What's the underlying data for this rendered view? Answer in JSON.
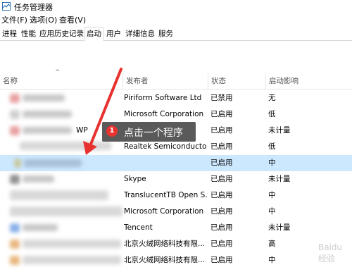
{
  "window": {
    "title": "任务管理器"
  },
  "menu": [
    "文件(F)",
    "选项(O)",
    "查看(V)"
  ],
  "tabs": [
    {
      "label": "进程"
    },
    {
      "label": "性能"
    },
    {
      "label": "应用历史记录"
    },
    {
      "label": "启动",
      "active": true
    },
    {
      "label": "用户"
    },
    {
      "label": "详细信息"
    },
    {
      "label": "服务"
    }
  ],
  "columns": {
    "name": "名称",
    "publisher": "发布者",
    "status": "状态",
    "impact": "启动影响"
  },
  "rows": [
    {
      "name_partial": "",
      "publisher": "Piriform Software Ltd",
      "status": "已禁用",
      "impact": "无"
    },
    {
      "name_partial": "",
      "publisher": "Microsoft Corporation",
      "status": "已启用",
      "impact": "低"
    },
    {
      "name_partial": "WP",
      "publisher": "",
      "status": "已启用",
      "impact": "未计量"
    },
    {
      "name_partial": "",
      "publisher": "Realtek Semiconductor",
      "status": "已启用",
      "impact": "低"
    },
    {
      "name_partial": "",
      "publisher": "",
      "status": "已启用",
      "impact": "中",
      "selected": true
    },
    {
      "name_partial": "",
      "publisher": "Skype",
      "status": "已启用",
      "impact": "未计量"
    },
    {
      "name_partial": "",
      "publisher": "TranslucentTB Open S...",
      "status": "已启用",
      "impact": "中"
    },
    {
      "name_partial": "",
      "publisher": "Microsoft Corporation",
      "status": "已启用",
      "impact": "中"
    },
    {
      "name_partial": "",
      "publisher": "Tencent",
      "status": "已启用",
      "impact": "未计量"
    },
    {
      "name_partial": "",
      "publisher": "北京火绒网络科技有限...",
      "status": "已启用",
      "impact": "高"
    },
    {
      "name_partial": "",
      "publisher": "北京火绒网络科技有限...",
      "status": "已启用",
      "impact": "中"
    }
  ],
  "annotation": {
    "step": "1",
    "text": "点击一个程序",
    "badge_color": "#e8322f",
    "arrow_color": "#e8322f"
  },
  "watermark": {
    "text": "Baidu 经验"
  }
}
